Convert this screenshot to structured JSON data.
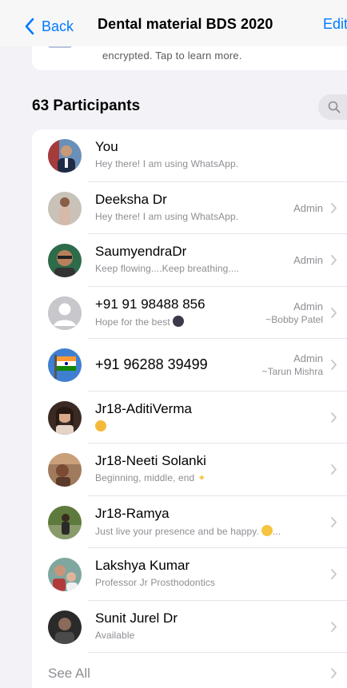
{
  "nav": {
    "back_label": "Back",
    "title": "Dental material BDS 2020",
    "edit_label": "Edit"
  },
  "encryption_note": "encrypted. Tap to learn more.",
  "participants_header": "63 Participants",
  "participants": [
    {
      "name": "You",
      "status": "Hey there! I am using WhatsApp.",
      "admin": "",
      "tag": ""
    },
    {
      "name": "Deeksha Dr",
      "status": "Hey there! I am using WhatsApp.",
      "admin": "Admin",
      "tag": ""
    },
    {
      "name": "SaumyendraDr",
      "status": "Keep flowing....Keep breathing....",
      "admin": "Admin",
      "tag": ""
    },
    {
      "name": "+91 91 98488 856",
      "status": "Hope for the best",
      "admin": "Admin",
      "tag": "~Bobby Patel"
    },
    {
      "name": "+91 96288 39499",
      "status": "",
      "admin": "Admin",
      "tag": "~Tarun Mishra"
    },
    {
      "name": "Jr18-AditiVerma",
      "status": "",
      "admin": "",
      "tag": ""
    },
    {
      "name": "Jr18-Neeti Solanki",
      "status": "Beginning, middle, end",
      "admin": "",
      "tag": ""
    },
    {
      "name": "Jr18-Ramya",
      "status": "Just live your presence and be happy.",
      "status_suffix": "...",
      "admin": "",
      "tag": ""
    },
    {
      "name": "Lakshya Kumar",
      "status": "Professor Jr Prosthodontics",
      "admin": "",
      "tag": ""
    },
    {
      "name": "Sunit Jurel Dr",
      "status": "Available",
      "admin": "",
      "tag": ""
    }
  ],
  "see_all_label": "See All",
  "colors": {
    "accent": "#007aff",
    "background": "#f2f2f7",
    "secondary_text": "#8e8e93"
  }
}
